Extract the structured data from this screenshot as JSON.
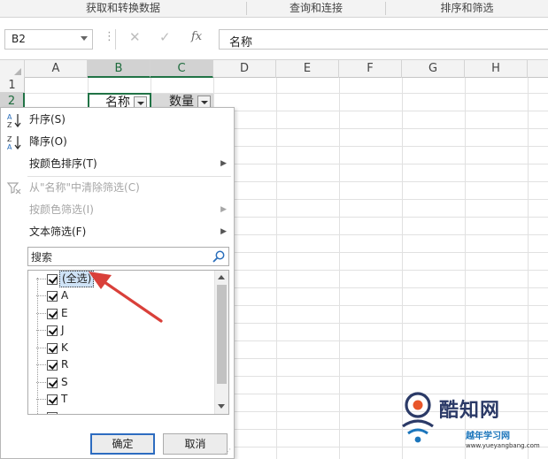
{
  "ribbon": {
    "groups": [
      "获取和转换数据",
      "查询和连接",
      "排序和筛选"
    ]
  },
  "formula_bar": {
    "name_box": "B2",
    "dots": "⋮",
    "cancel_glyph": "✕",
    "enter_glyph": "✓",
    "fx_glyph": "fx",
    "content": "名称"
  },
  "sheet": {
    "columns": [
      "A",
      "B",
      "C",
      "D",
      "E",
      "F",
      "G",
      "H"
    ],
    "rows": [
      "1",
      "2"
    ],
    "selected_cell": "B2",
    "cells": {
      "B2": "名称",
      "C2": "数量"
    }
  },
  "filter_menu": {
    "items": [
      {
        "label": "升序(S)",
        "enabled": true,
        "submenu": false
      },
      {
        "label": "降序(O)",
        "enabled": true,
        "submenu": false
      },
      {
        "label": "按颜色排序(T)",
        "enabled": true,
        "submenu": true
      },
      {
        "label": "从\"名称\"中清除筛选(C)",
        "enabled": false,
        "submenu": false
      },
      {
        "label": "按颜色筛选(I)",
        "enabled": false,
        "submenu": true
      },
      {
        "label": "文本筛选(F)",
        "enabled": true,
        "submenu": true
      }
    ],
    "sort_asc_icon_text": "A↓Z",
    "sort_desc_icon_text": "Z↓A",
    "submenu_arrow": "▶",
    "search_placeholder": "搜索",
    "list": [
      {
        "label": "(全选)",
        "checked": true
      },
      {
        "label": "A",
        "checked": true
      },
      {
        "label": "E",
        "checked": true
      },
      {
        "label": "J",
        "checked": true
      },
      {
        "label": "K",
        "checked": true
      },
      {
        "label": "R",
        "checked": true
      },
      {
        "label": "S",
        "checked": true
      },
      {
        "label": "T",
        "checked": true
      },
      {
        "label": "",
        "checked": true
      }
    ],
    "ok_label": "确定",
    "cancel_label": "取消"
  },
  "watermark": {
    "name": "酷知网",
    "sub": "越年学习网",
    "url": "www.yueyangbang.com"
  },
  "colors": {
    "accent_green": "#217346",
    "annotation_red": "#d9403a",
    "ok_button_border": "#2d6cc0"
  },
  "icons": [
    "sort-ascending-icon",
    "sort-descending-icon",
    "clear-filter-icon",
    "search-icon",
    "submenu-arrow-icon",
    "checkbox-checked-icon",
    "filter-dropdown-icon"
  ]
}
